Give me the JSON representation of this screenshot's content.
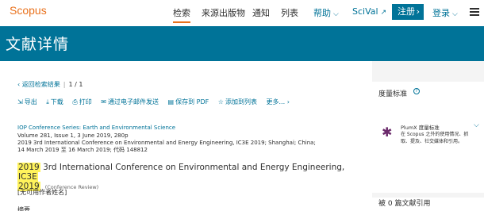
{
  "nav": {
    "logo": "Scopus",
    "links": [
      "检索",
      "来源出版物",
      "通知",
      "列表"
    ],
    "help": "帮助",
    "scival": "SciVal",
    "register": "注册",
    "login": "登录"
  },
  "banner": {
    "title": "文献详情"
  },
  "back": {
    "label": "返回检索结果",
    "page": "1 / 1"
  },
  "actions": [
    {
      "icon": "export-icon",
      "glyph": "⇲",
      "label": "导出"
    },
    {
      "icon": "download-icon",
      "glyph": "⤓",
      "label": "下载"
    },
    {
      "icon": "print-icon",
      "glyph": "⎙",
      "label": "打印"
    },
    {
      "icon": "email-icon",
      "glyph": "✉",
      "label": "通过电子邮件发送"
    },
    {
      "icon": "pdf-icon",
      "glyph": "▤",
      "label": "保存到 PDF"
    },
    {
      "icon": "star-icon",
      "glyph": "☆",
      "label": "添加到列表"
    },
    {
      "icon": "more-icon",
      "glyph": "",
      "label": "更多..."
    }
  ],
  "source_title": "IOP Conference Series: Earth and Environmental Science",
  "meta_lines": [
    "Volume 281, Issue 1, 3 June 2019, 280p",
    "2019 3rd International Conference on Environmental and Energy Engineering, IC3E 2019; Shanghai; China;",
    "14 March 2019 至 16 March 2019; 代码 148812"
  ],
  "title_parts": {
    "hl1": "2019",
    "mid": " 3rd International Conference on Environmental and Energy Engineering, ",
    "hl2": "IC3E",
    "hl3": "2019",
    "type": "(Conference Review)"
  },
  "no_author": "[无可用作者姓名]",
  "abstract_peek": "摘要",
  "sidebar": {
    "metrics_heading": "度量标准",
    "help_glyph": "?",
    "plumx_title": "PlumX 度量标准",
    "plumx_desc": "在 Scopus 之外的使用情况、抓取、提及、社交媒体和引用。",
    "citations_heading": "被 0 篇文献引用"
  },
  "colors": {
    "brand": "#e9711c",
    "primary": "#007398",
    "highlight": "#fff35c"
  }
}
